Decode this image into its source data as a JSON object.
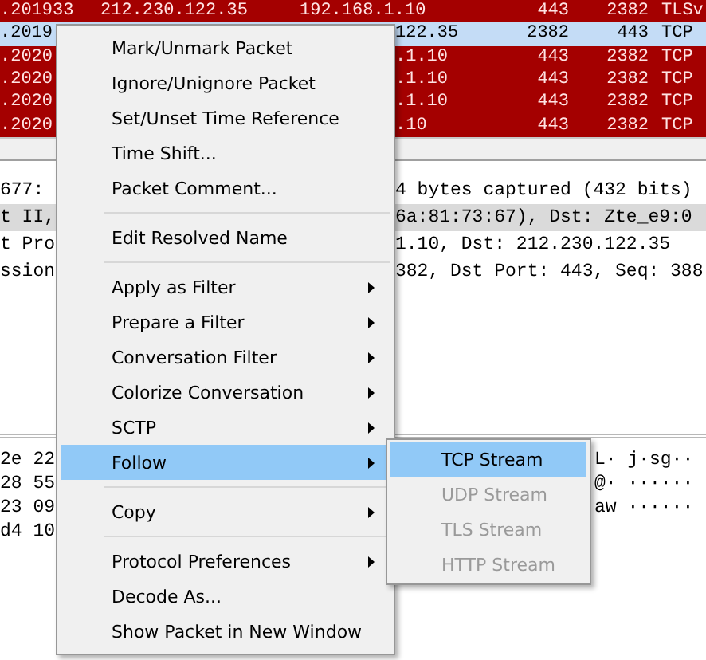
{
  "packet_list": {
    "rows": [
      {
        "selected": false,
        "time": ".201933",
        "source": "212.230.122.35",
        "destination": "192.168.1.10",
        "src_port": "443",
        "dst_port": "2382",
        "protocol": "TLSv"
      },
      {
        "selected": true,
        "time": ".2019",
        "destination": "122.35",
        "src_port": "2382",
        "dst_port": "443",
        "protocol": "TCP"
      },
      {
        "selected": false,
        "time": ".2020",
        "destination": ".1.10",
        "src_port": "443",
        "dst_port": "2382",
        "protocol": "TCP"
      },
      {
        "selected": false,
        "time": ".2020",
        "destination": ".1.10",
        "src_port": "443",
        "dst_port": "2382",
        "protocol": "TCP"
      },
      {
        "selected": false,
        "time": ".2020",
        "destination": ".1.10",
        "src_port": "443",
        "dst_port": "2382",
        "protocol": "TCP"
      },
      {
        "selected": false,
        "time": ".2020",
        "destination": ".10",
        "src_port": "443",
        "dst_port": "2382",
        "protocol": "TCP"
      }
    ]
  },
  "packet_details": {
    "lines": [
      {
        "selected": false,
        "left": "677:",
        "right": "4 bytes captured (432 bits)"
      },
      {
        "selected": true,
        "left": "t II,",
        "right": "6a:81:73:67), Dst: Zte_e9:0"
      },
      {
        "selected": false,
        "left": "t Pro",
        "right": "1.10, Dst: 212.230.122.35"
      },
      {
        "selected": false,
        "left": "ssion",
        "right": "382, Dst Port: 443, Seq: 388"
      }
    ]
  },
  "packet_bytes": {
    "lines": [
      {
        "hex": "2e 22",
        "ascii": "L· j·sg··"
      },
      {
        "hex": "28 55",
        "ascii": "@· ······"
      },
      {
        "hex": "23 09",
        "ascii": "aw ······"
      },
      {
        "hex": "d4 10"
      }
    ]
  },
  "context_menu": {
    "items": [
      {
        "kind": "item",
        "label": "Mark/Unmark Packet",
        "submenu": false,
        "selected": false
      },
      {
        "kind": "item",
        "label": "Ignore/Unignore Packet",
        "submenu": false,
        "selected": false
      },
      {
        "kind": "item",
        "label": "Set/Unset Time Reference",
        "submenu": false,
        "selected": false
      },
      {
        "kind": "item",
        "label": "Time Shift...",
        "submenu": false,
        "selected": false
      },
      {
        "kind": "item",
        "label": "Packet Comment...",
        "submenu": false,
        "selected": false
      },
      {
        "kind": "separator"
      },
      {
        "kind": "item",
        "label": "Edit Resolved Name",
        "submenu": false,
        "selected": false
      },
      {
        "kind": "separator"
      },
      {
        "kind": "item",
        "label": "Apply as Filter",
        "submenu": true,
        "selected": false
      },
      {
        "kind": "item",
        "label": "Prepare a Filter",
        "submenu": true,
        "selected": false
      },
      {
        "kind": "item",
        "label": "Conversation Filter",
        "submenu": true,
        "selected": false
      },
      {
        "kind": "item",
        "label": "Colorize Conversation",
        "submenu": true,
        "selected": false
      },
      {
        "kind": "item",
        "label": "SCTP",
        "submenu": true,
        "selected": false
      },
      {
        "kind": "item",
        "label": "Follow",
        "submenu": true,
        "selected": true
      },
      {
        "kind": "separator"
      },
      {
        "kind": "item",
        "label": "Copy",
        "submenu": true,
        "selected": false
      },
      {
        "kind": "separator"
      },
      {
        "kind": "item",
        "label": "Protocol Preferences",
        "submenu": true,
        "selected": false
      },
      {
        "kind": "item",
        "label": "Decode As...",
        "submenu": false,
        "selected": false
      },
      {
        "kind": "item",
        "label": "Show Packet in New Window",
        "submenu": false,
        "selected": false
      }
    ]
  },
  "follow_submenu": {
    "items": [
      {
        "label": "TCP Stream",
        "selected": true,
        "disabled": false
      },
      {
        "label": "UDP Stream",
        "selected": false,
        "disabled": true
      },
      {
        "label": "TLS Stream",
        "selected": false,
        "disabled": true
      },
      {
        "label": "HTTP Stream",
        "selected": false,
        "disabled": true
      }
    ]
  }
}
